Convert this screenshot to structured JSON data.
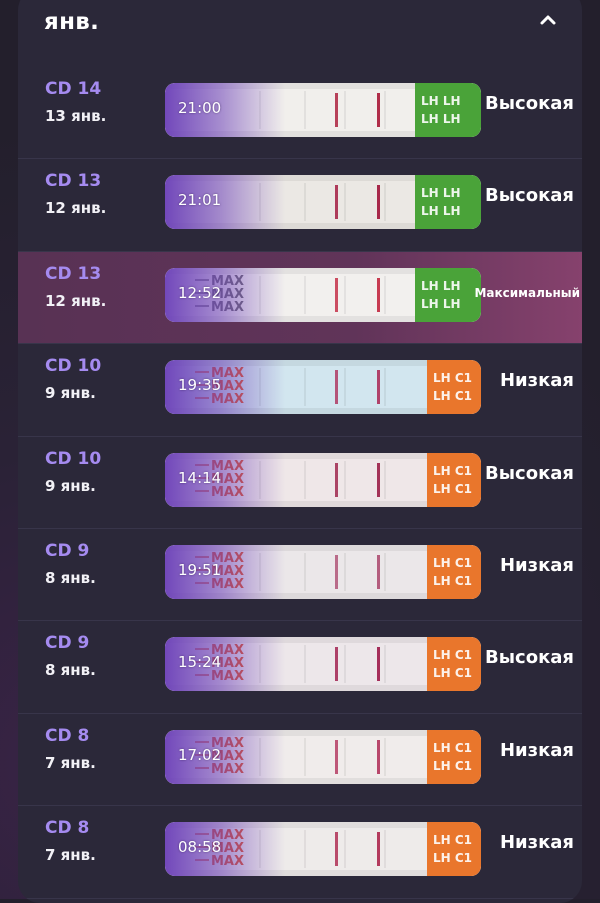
{
  "header": {
    "month": "янв."
  },
  "colors": {
    "cd": "#a58bf0",
    "highlight": "#7d3a6a",
    "green": "#4aa339",
    "orange": "#e9762c",
    "purple": "#6b3fb8"
  },
  "rows": [
    {
      "cd": "CD 14",
      "date": "13 янв.",
      "time": "21:00",
      "level": "Высокая",
      "brand": "green",
      "max_label": "",
      "bg": "#f1efec",
      "line": "#b02d49",
      "highlight": false
    },
    {
      "cd": "CD 13",
      "date": "12 янв.",
      "time": "21:01",
      "level": "Высокая",
      "brand": "green",
      "max_label": "",
      "bg": "#ebe8e4",
      "line": "#a7284a",
      "highlight": false
    },
    {
      "cd": "CD 13",
      "date": "12 янв.",
      "time": "12:52",
      "level": "Максимальный",
      "brand": "green",
      "max_label": "MAX",
      "bg": "#f2f0ee",
      "line": "#c73b51",
      "highlight": true
    },
    {
      "cd": "CD 10",
      "date": "9 янв.",
      "time": "19:35",
      "level": "Низкая",
      "brand": "orange",
      "max_label": "MAX",
      "bg": "#d2e6ef",
      "line": "#b0426a",
      "highlight": false
    },
    {
      "cd": "CD 10",
      "date": "9 янв.",
      "time": "14:14",
      "level": "Высокая",
      "brand": "orange",
      "max_label": "MAX",
      "bg": "#efe7e8",
      "line": "#a33257",
      "highlight": false
    },
    {
      "cd": "CD 9",
      "date": "8 янв.",
      "time": "19:51",
      "level": "Низкая",
      "brand": "orange",
      "max_label": "MAX",
      "bg": "#ebe7e9",
      "line": "#b45d7e",
      "highlight": false
    },
    {
      "cd": "CD 9",
      "date": "8 янв.",
      "time": "15:24",
      "level": "Высокая",
      "brand": "orange",
      "max_label": "MAX",
      "bg": "#ede7ea",
      "line": "#a52e5a",
      "highlight": false
    },
    {
      "cd": "CD 8",
      "date": "7 янв.",
      "time": "17:02",
      "level": "Низкая",
      "brand": "orange",
      "max_label": "MAX",
      "bg": "#f0eceb",
      "line": "#b8476b",
      "highlight": false
    },
    {
      "cd": "CD 8",
      "date": "7 янв.",
      "time": "08:58",
      "level": "Низкая",
      "brand": "orange",
      "max_label": "MAX",
      "bg": "#eeebea",
      "line": "#b33a5d",
      "highlight": false
    }
  ]
}
